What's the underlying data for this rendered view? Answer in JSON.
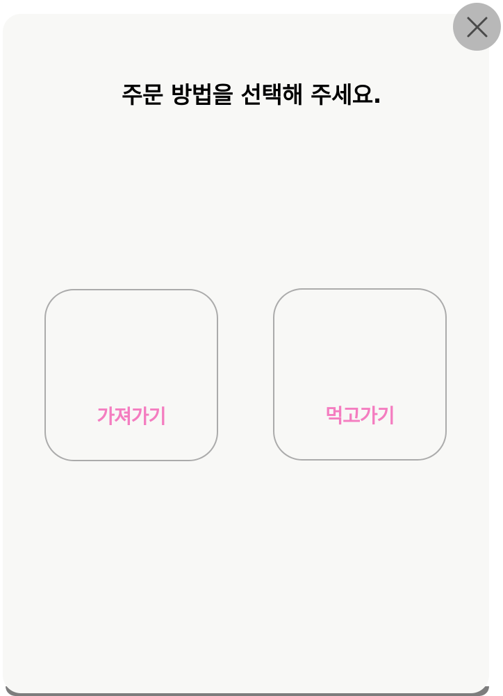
{
  "modal": {
    "title": "주문 방법을 선택해 주세요.",
    "close_icon": "close-icon"
  },
  "options": [
    {
      "label": "가져가기",
      "color": "#f47dc0"
    },
    {
      "label": "먹고가기",
      "color": "#f47dc0"
    }
  ],
  "colors": {
    "modal_background": "#f8f8f6",
    "card_border": "#ababab",
    "close_button_background": "#b8b8b8"
  }
}
